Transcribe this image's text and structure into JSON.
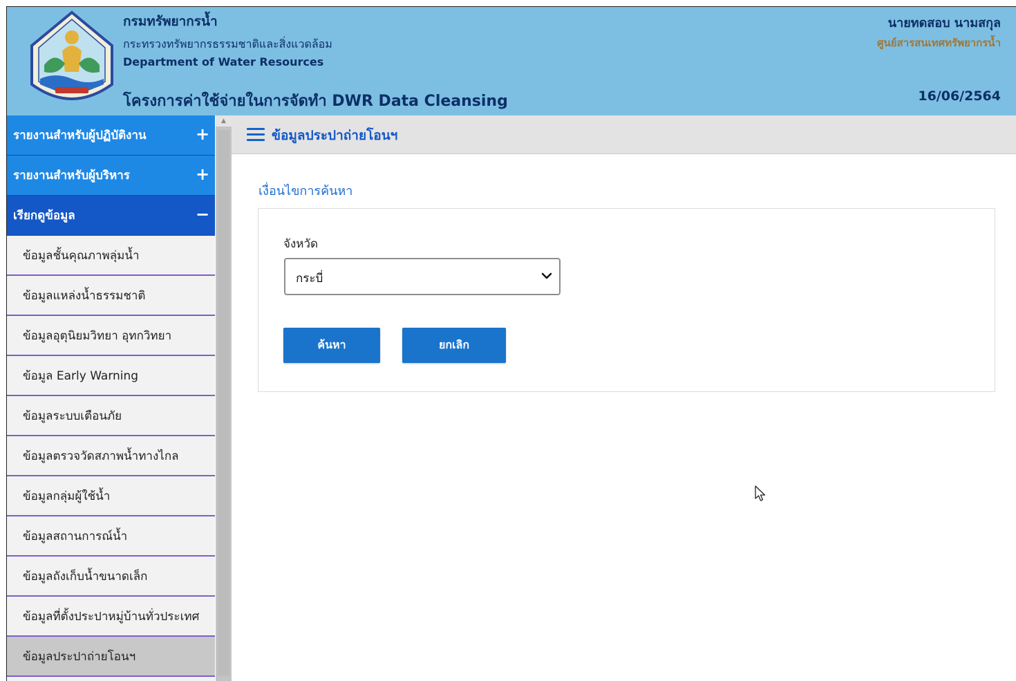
{
  "header": {
    "org_th": "กรมทรัพยากรน้ำ",
    "ministry": "กระทรวงทรัพยากรธรรมชาติและสิ่งแวดล้อม",
    "org_en": "Department of Water Resources",
    "project": "โครงการค่าใช้จ่ายในการจัดทำ DWR Data Cleansing",
    "user_name": "นายทดสอบ นามสกุล",
    "user_dept": "ศูนย์สารสนเทศทรัพยากรน้ำ",
    "date": "16/06/2564"
  },
  "sidebar": {
    "categories": [
      {
        "label": "รายงานสำหรับผู้ปฏิบัติงาน",
        "toggle": "+"
      },
      {
        "label": "รายงานสำหรับผู้บริหาร",
        "toggle": "+"
      },
      {
        "label": "เรียกดูข้อมูล",
        "toggle": "−"
      }
    ],
    "items": [
      {
        "label": "ข้อมูลชั้นคุณภาพลุ่มน้ำ"
      },
      {
        "label": "ข้อมูลแหล่งน้ำธรรมชาติ"
      },
      {
        "label": "ข้อมูลอุตุนิยมวิทยา อุทกวิทยา"
      },
      {
        "label": "ข้อมูล Early Warning"
      },
      {
        "label": "ข้อมูลระบบเตือนภัย"
      },
      {
        "label": "ข้อมูลตรวจวัดสภาพน้ำทางไกล"
      },
      {
        "label": "ข้อมูลกลุ่มผู้ใช้น้ำ"
      },
      {
        "label": "ข้อมูลสถานการณ์น้ำ"
      },
      {
        "label": "ข้อมูลถังเก็บน้ำขนาดเล็ก"
      },
      {
        "label": "ข้อมูลที่ตั้งประปาหมู่บ้านทั่วประเทศ"
      },
      {
        "label": "ข้อมูลประปาถ่ายโอนฯ"
      }
    ]
  },
  "main": {
    "page_title": "ข้อมูลประปาถ่ายโอนฯ",
    "section_label": "เงื่อนไขการค้นหา",
    "province_label": "จังหวัด",
    "province_value": "กระบี่",
    "search_button": "ค้นหา",
    "cancel_button": "ยกเลิก"
  },
  "icons": {
    "menu": "hamburger-icon",
    "dropdown": "chevron-down-icon",
    "cursor": "mouse-pointer-icon"
  },
  "colors": {
    "header_bg": "#7dbfe3",
    "category_collapsed": "#1e88e5",
    "category_expanded": "#1457c7",
    "button": "#1a74cc",
    "divider": "#7e5ec9"
  }
}
